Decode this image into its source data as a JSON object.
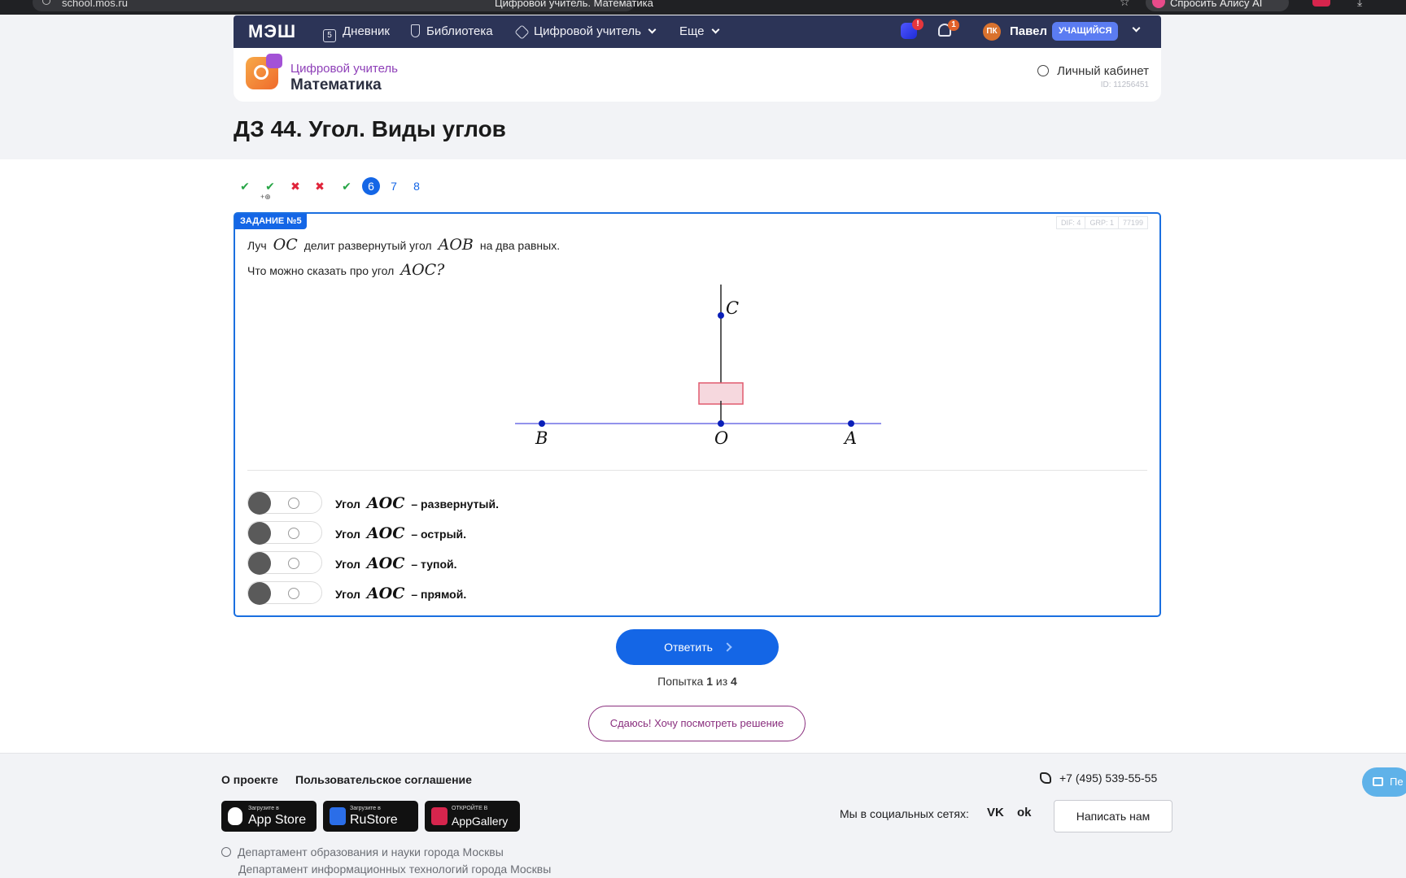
{
  "browser": {
    "url": "school.mos.ru",
    "tab_title": "Цифровой учитель. Математика",
    "alice_label": "Спросить Алису AI"
  },
  "nav": {
    "logo": "МЭШ",
    "diary": "Дневник",
    "library": "Библиотека",
    "digital_teacher": "Цифровой учитель",
    "more": "Еще",
    "badge_count": "!",
    "bell_count": "1",
    "avatar_initials": "ПК",
    "user_name": "Павел",
    "role": "УЧАЩИЙСЯ"
  },
  "header": {
    "subtitle": "Цифровой учитель",
    "subject": "Математика",
    "cabinet": "Личный кабинет",
    "user_id": "ID: 11256451"
  },
  "page_title": "ДЗ 44. Угол. Виды углов",
  "steps": [
    {
      "label": "✔",
      "state": "correct"
    },
    {
      "label": "✔",
      "state": "correct"
    },
    {
      "label": "✖",
      "state": "wrong"
    },
    {
      "label": "✖",
      "state": "wrong"
    },
    {
      "label": "✔",
      "state": "correct"
    },
    {
      "label": "6",
      "state": "current"
    },
    {
      "label": "7",
      "state": "pending"
    },
    {
      "label": "8",
      "state": "pending"
    }
  ],
  "step_sub": "+⊕",
  "task": {
    "tag": "ЗАДАНИЕ №5",
    "meta": [
      "DIF: 4",
      "GRP: 1",
      "77199"
    ],
    "q1_pre": "Луч",
    "q1_ray": "OC",
    "q1_mid": "делит развернутый угол",
    "q1_angle": "AOB",
    "q1_post": "на два равных.",
    "q2_pre": "Что можно сказать про угол",
    "q2_angle": "AOC?",
    "figure_labels": {
      "C": "C",
      "B": "B",
      "O": "O",
      "A": "A"
    },
    "options": [
      {
        "pre": "Угол",
        "angle": "AOC",
        "post": "– развернутый."
      },
      {
        "pre": "Угол",
        "angle": "AOC",
        "post": "– острый."
      },
      {
        "pre": "Угол",
        "angle": "AOC",
        "post": "– тупой."
      },
      {
        "pre": "Угол",
        "angle": "AOC",
        "post": "– прямой."
      }
    ]
  },
  "answer_button": "Ответить",
  "tries": {
    "pre": "Попытка",
    "current": "1",
    "mid": "из",
    "total": "4"
  },
  "give_up_button": "Сдаюсь! Хочу посмотреть решение",
  "footer": {
    "about": "О проекте",
    "agreement": "Пользовательское соглашение",
    "app_store_small": "Загрузите в",
    "app_store": "App Store",
    "rustore_small": "Загрузите в",
    "rustore": "RuStore",
    "appgallery_small": "ОТКРОЙТЕ В",
    "appgallery": "AppGallery",
    "phone": "+7 (495) 539-55-55",
    "social": "Мы в социальных сетях:",
    "vk": "VK",
    "ok": "ok",
    "write": "Написать нам",
    "copy1": "Департамент образования и науки города Москвы",
    "copy2": "Департамент информационных технологий города Москвы",
    "float_label": "Пе"
  },
  "colors": {
    "nav_bg": "#2c3457",
    "accent": "#1466e6",
    "correct": "#27a546",
    "wrong": "#e0243a",
    "purple": "#8a2f7e"
  }
}
